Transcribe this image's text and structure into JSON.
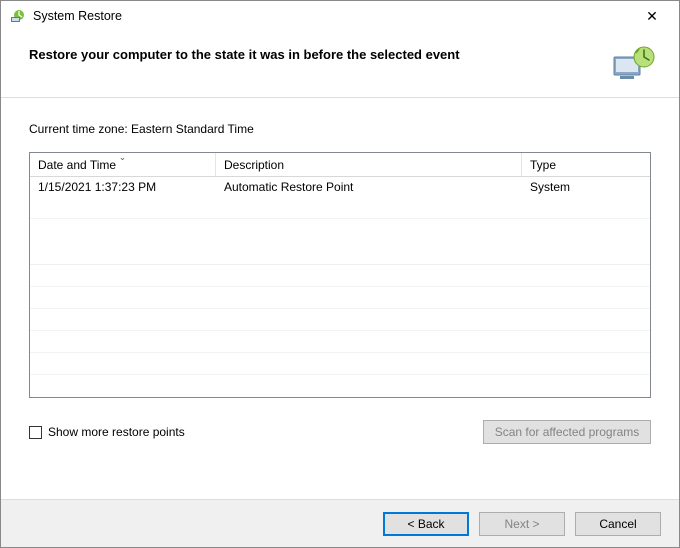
{
  "title": "System Restore",
  "heading": "Restore your computer to the state it was in before the selected event",
  "timezone_label": "Current time zone: Eastern Standard Time",
  "table": {
    "headers": {
      "date": "Date and Time",
      "desc": "Description",
      "type": "Type"
    },
    "rows": [
      {
        "date": "1/15/2021 1:37:23 PM",
        "desc": "Automatic Restore Point",
        "type": "System"
      }
    ]
  },
  "show_more_label": "Show more restore points",
  "scan_label": "Scan for affected programs",
  "buttons": {
    "back": "< Back",
    "next": "Next >",
    "cancel": "Cancel"
  },
  "close_glyph": "✕"
}
